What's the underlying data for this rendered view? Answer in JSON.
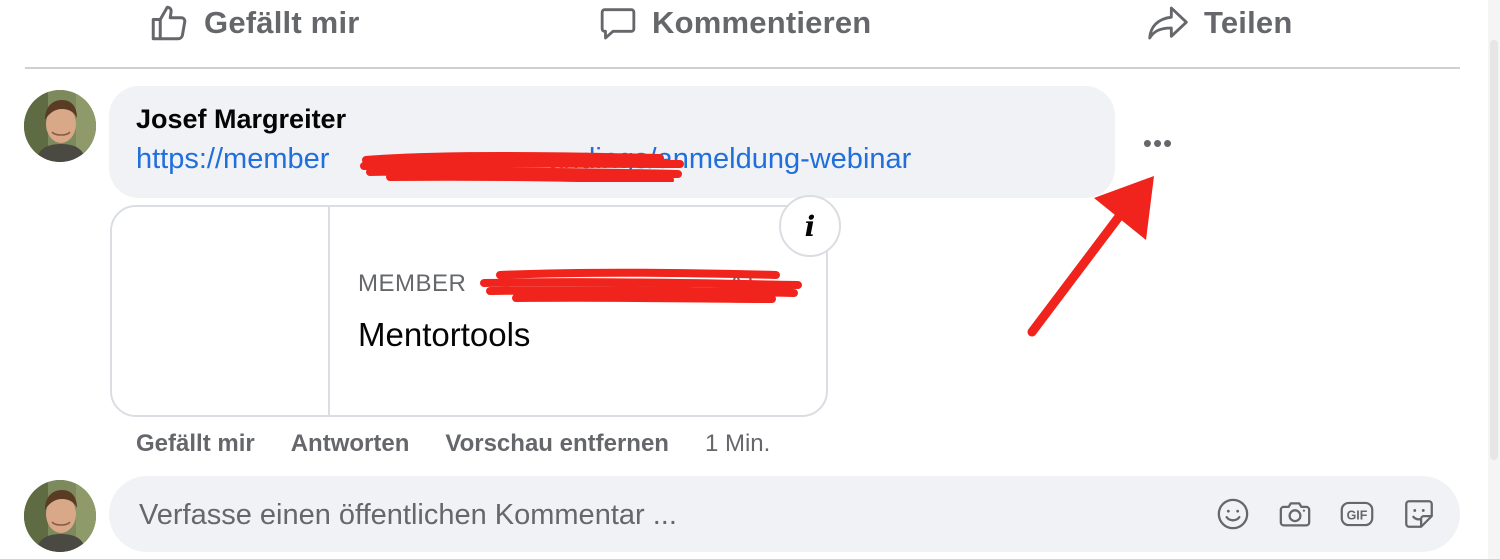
{
  "action_bar": {
    "like_label": "Gefällt mir",
    "comment_label": "Kommentieren",
    "share_label": "Teilen",
    "like_icon": "thumbs-up-icon",
    "comment_icon": "speech-bubble-icon",
    "share_icon": "share-arrow-icon"
  },
  "comment": {
    "author": "Josef Margreiter",
    "link_text": "https://member                           andings/anmeldung-webinar",
    "more_label": "•••",
    "preview": {
      "domain": "MEMBER",
      "domain_suffix": "AT",
      "title": "Mentortools",
      "info_label": "i"
    },
    "actions": {
      "like": "Gefällt mir",
      "reply": "Antworten",
      "remove_preview": "Vorschau entfernen",
      "time": "1 Min."
    }
  },
  "composer": {
    "placeholder": "Verfasse einen öffentlichen Kommentar ...",
    "icons": [
      "smiley-icon",
      "camera-icon",
      "gif-icon",
      "sticker-icon"
    ]
  },
  "colors": {
    "link": "#216fdb",
    "muted": "#65676b",
    "bubble": "#f0f2f5",
    "annotation_red": "#f0241c"
  }
}
